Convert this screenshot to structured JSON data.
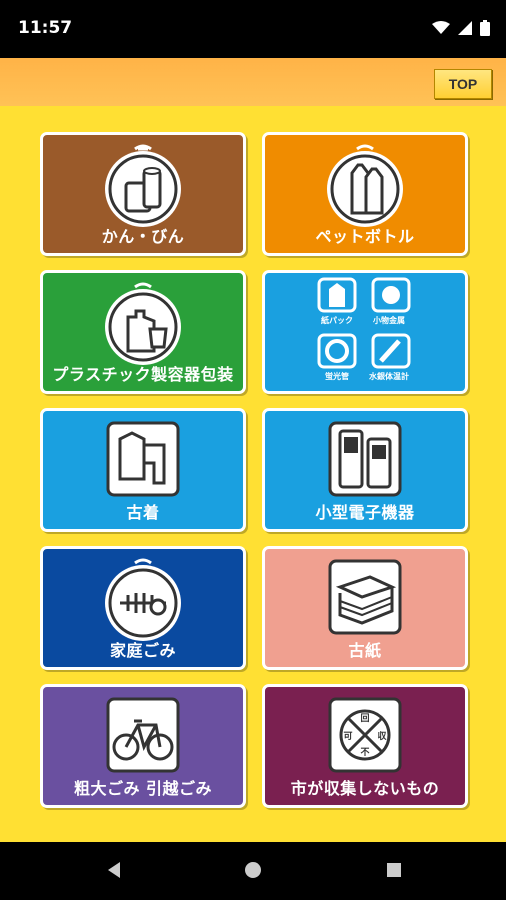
{
  "status": {
    "time": "11:57"
  },
  "header": {
    "top_label": "TOP"
  },
  "tiles": [
    {
      "label": "かん・びん",
      "color": "#9a5a2a"
    },
    {
      "label": "ペットボトル",
      "color": "#f08c00"
    },
    {
      "label": "プラスチック製容器包装",
      "color": "#2aa03a"
    },
    {
      "label": "",
      "color": "#1aa0e0",
      "subs": [
        "紙パック",
        "小物金属",
        "蛍光管",
        "水銀体温計"
      ]
    },
    {
      "label": "古着",
      "color": "#1aa0e0"
    },
    {
      "label": "小型電子機器",
      "color": "#1aa0e0"
    },
    {
      "label": "家庭ごみ",
      "color": "#0a4aa0"
    },
    {
      "label": "古紙",
      "color": "#f0a090"
    },
    {
      "label": "粗大ごみ 引越ごみ",
      "color": "#6a50a0"
    },
    {
      "label": "市が収集しないもの",
      "color": "#7a2050"
    }
  ],
  "forbid_icon_chars": [
    "回",
    "収",
    "不",
    "可"
  ]
}
